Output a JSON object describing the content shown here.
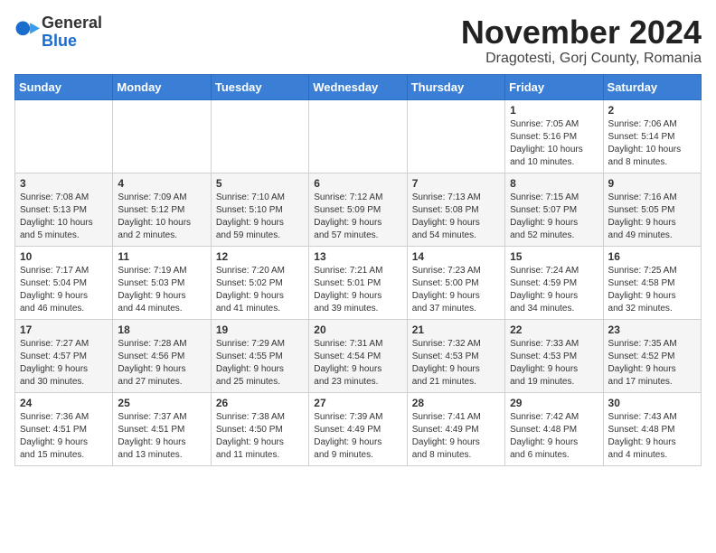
{
  "logo": {
    "general": "General",
    "blue": "Blue"
  },
  "header": {
    "month_year": "November 2024",
    "location": "Dragotesti, Gorj County, Romania"
  },
  "weekdays": [
    "Sunday",
    "Monday",
    "Tuesday",
    "Wednesday",
    "Thursday",
    "Friday",
    "Saturday"
  ],
  "weeks": [
    [
      {
        "day": "",
        "info": ""
      },
      {
        "day": "",
        "info": ""
      },
      {
        "day": "",
        "info": ""
      },
      {
        "day": "",
        "info": ""
      },
      {
        "day": "",
        "info": ""
      },
      {
        "day": "1",
        "info": "Sunrise: 7:05 AM\nSunset: 5:16 PM\nDaylight: 10 hours\nand 10 minutes."
      },
      {
        "day": "2",
        "info": "Sunrise: 7:06 AM\nSunset: 5:14 PM\nDaylight: 10 hours\nand 8 minutes."
      }
    ],
    [
      {
        "day": "3",
        "info": "Sunrise: 7:08 AM\nSunset: 5:13 PM\nDaylight: 10 hours\nand 5 minutes."
      },
      {
        "day": "4",
        "info": "Sunrise: 7:09 AM\nSunset: 5:12 PM\nDaylight: 10 hours\nand 2 minutes."
      },
      {
        "day": "5",
        "info": "Sunrise: 7:10 AM\nSunset: 5:10 PM\nDaylight: 9 hours\nand 59 minutes."
      },
      {
        "day": "6",
        "info": "Sunrise: 7:12 AM\nSunset: 5:09 PM\nDaylight: 9 hours\nand 57 minutes."
      },
      {
        "day": "7",
        "info": "Sunrise: 7:13 AM\nSunset: 5:08 PM\nDaylight: 9 hours\nand 54 minutes."
      },
      {
        "day": "8",
        "info": "Sunrise: 7:15 AM\nSunset: 5:07 PM\nDaylight: 9 hours\nand 52 minutes."
      },
      {
        "day": "9",
        "info": "Sunrise: 7:16 AM\nSunset: 5:05 PM\nDaylight: 9 hours\nand 49 minutes."
      }
    ],
    [
      {
        "day": "10",
        "info": "Sunrise: 7:17 AM\nSunset: 5:04 PM\nDaylight: 9 hours\nand 46 minutes."
      },
      {
        "day": "11",
        "info": "Sunrise: 7:19 AM\nSunset: 5:03 PM\nDaylight: 9 hours\nand 44 minutes."
      },
      {
        "day": "12",
        "info": "Sunrise: 7:20 AM\nSunset: 5:02 PM\nDaylight: 9 hours\nand 41 minutes."
      },
      {
        "day": "13",
        "info": "Sunrise: 7:21 AM\nSunset: 5:01 PM\nDaylight: 9 hours\nand 39 minutes."
      },
      {
        "day": "14",
        "info": "Sunrise: 7:23 AM\nSunset: 5:00 PM\nDaylight: 9 hours\nand 37 minutes."
      },
      {
        "day": "15",
        "info": "Sunrise: 7:24 AM\nSunset: 4:59 PM\nDaylight: 9 hours\nand 34 minutes."
      },
      {
        "day": "16",
        "info": "Sunrise: 7:25 AM\nSunset: 4:58 PM\nDaylight: 9 hours\nand 32 minutes."
      }
    ],
    [
      {
        "day": "17",
        "info": "Sunrise: 7:27 AM\nSunset: 4:57 PM\nDaylight: 9 hours\nand 30 minutes."
      },
      {
        "day": "18",
        "info": "Sunrise: 7:28 AM\nSunset: 4:56 PM\nDaylight: 9 hours\nand 27 minutes."
      },
      {
        "day": "19",
        "info": "Sunrise: 7:29 AM\nSunset: 4:55 PM\nDaylight: 9 hours\nand 25 minutes."
      },
      {
        "day": "20",
        "info": "Sunrise: 7:31 AM\nSunset: 4:54 PM\nDaylight: 9 hours\nand 23 minutes."
      },
      {
        "day": "21",
        "info": "Sunrise: 7:32 AM\nSunset: 4:53 PM\nDaylight: 9 hours\nand 21 minutes."
      },
      {
        "day": "22",
        "info": "Sunrise: 7:33 AM\nSunset: 4:53 PM\nDaylight: 9 hours\nand 19 minutes."
      },
      {
        "day": "23",
        "info": "Sunrise: 7:35 AM\nSunset: 4:52 PM\nDaylight: 9 hours\nand 17 minutes."
      }
    ],
    [
      {
        "day": "24",
        "info": "Sunrise: 7:36 AM\nSunset: 4:51 PM\nDaylight: 9 hours\nand 15 minutes."
      },
      {
        "day": "25",
        "info": "Sunrise: 7:37 AM\nSunset: 4:51 PM\nDaylight: 9 hours\nand 13 minutes."
      },
      {
        "day": "26",
        "info": "Sunrise: 7:38 AM\nSunset: 4:50 PM\nDaylight: 9 hours\nand 11 minutes."
      },
      {
        "day": "27",
        "info": "Sunrise: 7:39 AM\nSunset: 4:49 PM\nDaylight: 9 hours\nand 9 minutes."
      },
      {
        "day": "28",
        "info": "Sunrise: 7:41 AM\nSunset: 4:49 PM\nDaylight: 9 hours\nand 8 minutes."
      },
      {
        "day": "29",
        "info": "Sunrise: 7:42 AM\nSunset: 4:48 PM\nDaylight: 9 hours\nand 6 minutes."
      },
      {
        "day": "30",
        "info": "Sunrise: 7:43 AM\nSunset: 4:48 PM\nDaylight: 9 hours\nand 4 minutes."
      }
    ]
  ]
}
